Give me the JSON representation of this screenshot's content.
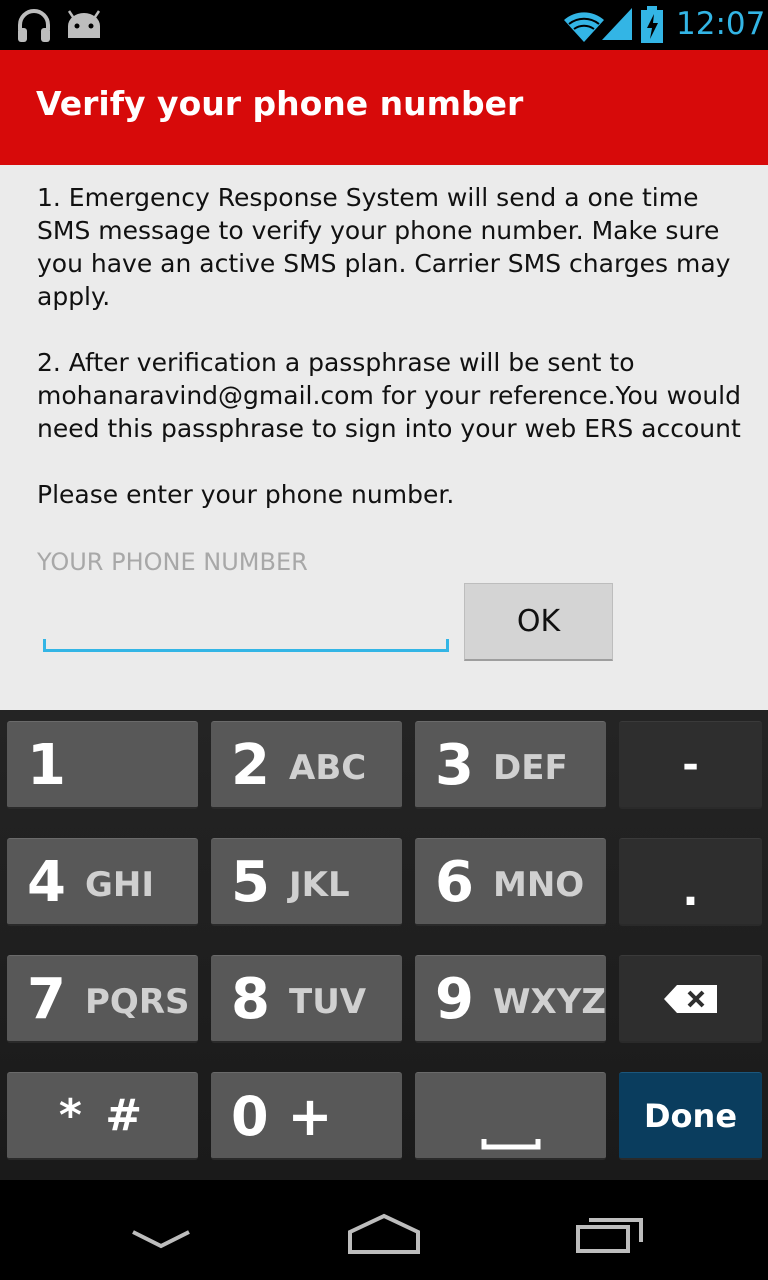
{
  "status_bar": {
    "time": "12:07",
    "icons": [
      "headphones-icon",
      "android-icon",
      "wifi-icon",
      "signal-icon",
      "battery-charging-icon"
    ]
  },
  "header": {
    "title": "Verify your phone number",
    "background": "#d70a0a"
  },
  "content": {
    "paragraph1": "1. Emergency Response System will send a one time SMS message to verify your phone number. Make sure you have an active SMS plan. Carrier SMS charges may apply.",
    "paragraph2": "2. After verification a passphrase will be sent to mohanaravind@gmail.com for your reference.You would need this passphrase to sign into your web ERS account",
    "paragraph3": "Please enter your phone number.",
    "field_label": "YOUR PHONE NUMBER",
    "phone_value": "",
    "ok_label": "OK"
  },
  "keyboard": {
    "keys": [
      {
        "num": "1",
        "letters": ""
      },
      {
        "num": "2",
        "letters": "ABC"
      },
      {
        "num": "3",
        "letters": "DEF"
      },
      {
        "num": "4",
        "letters": "GHI"
      },
      {
        "num": "5",
        "letters": "JKL"
      },
      {
        "num": "6",
        "letters": "MNO"
      },
      {
        "num": "7",
        "letters": "PQRS"
      },
      {
        "num": "8",
        "letters": "TUV"
      },
      {
        "num": "9",
        "letters": "WXYZ"
      }
    ],
    "dash": "-",
    "dot": ".",
    "star_hash": "* #",
    "zero_plus": "0 +",
    "done": "Done",
    "accent": "#33b5e5"
  },
  "nav_bar": {
    "icons": [
      "back-icon",
      "home-icon",
      "recent-apps-icon"
    ]
  }
}
